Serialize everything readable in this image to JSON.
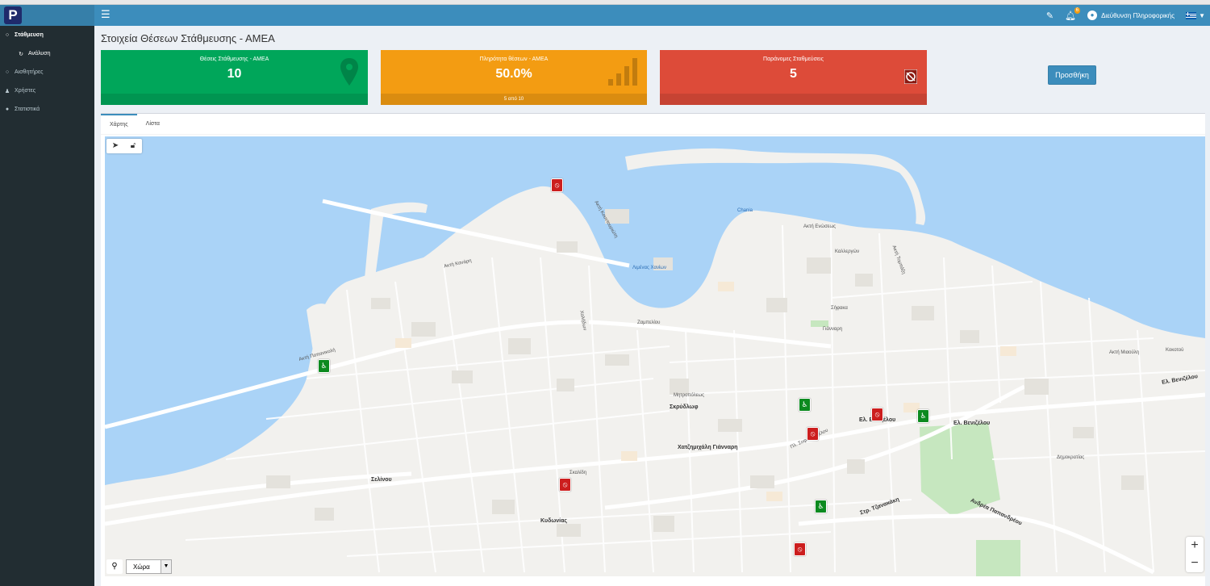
{
  "app": {
    "logo_letter": "P",
    "nav_toggle_icon": "hamburger-icon",
    "user_name": "Διεύθυνση Πληροφορικής",
    "notification_count": "6"
  },
  "sidebar": {
    "items": [
      {
        "label": "Στάθμευση",
        "icon": "circle-icon",
        "active": true
      },
      {
        "label": "Ανάλυση",
        "icon": "refresh-icon",
        "sub": true
      },
      {
        "label": "Αισθητήρες",
        "icon": "circle-icon"
      },
      {
        "label": "Χρήστες",
        "icon": "user-icon"
      },
      {
        "label": "Στατιστικά",
        "icon": "globe-icon"
      }
    ]
  },
  "page": {
    "title": "Στοιχεία Θέσεων Στάθμευσης - ΑΜΕΑ"
  },
  "stats": {
    "spaces_label": "Θέσεις Στάθμευσης - ΑΜΕΑ",
    "spaces_value": "10",
    "occupancy_label": "Πληρότητα θέσεων - ΑΜΕΑ",
    "occupancy_value": "50.0%",
    "occupancy_footer": "5 από 10",
    "illegal_label": "Παράνομες Σταθμεύσεις",
    "illegal_value": "5",
    "colors": {
      "green": "#00a65a",
      "orange": "#f39c12",
      "red": "#dd4b39"
    }
  },
  "actions": {
    "add_label": "Προσθήκη"
  },
  "tabs": [
    {
      "label": "Χάρτης",
      "active": true
    },
    {
      "label": "Λίστα",
      "active": false
    }
  ],
  "map": {
    "region_select": "Χώρα",
    "harbor_label": "Λιμένας Χανίων",
    "poi_label": "Chania",
    "streets": {
      "akti_koundourioti": "Ακτή Κουντουριώτη",
      "akti_enoseos": "Ακτή Ενώσεως",
      "akti_kanari": "Ακτή Κανάρη",
      "akti_papanikoli": "Ακτή Παπανικολή",
      "el_venizelou_1": "Ελ. Βενιζέλου",
      "el_venizelou_2": "Ελ. Βενιζέλου",
      "el_venizelou_3": "Ελ. Βενιζέλου",
      "andrea_papandreou": "Ανδρέα Παπανδρέου",
      "str_tzanakaki": "Στρ. Τζανακάκη",
      "selinou": "Σελίνου",
      "kydonias": "Κυδωνίας",
      "chatzimichali": "Χατζημιχάλη Γιάνναρη",
      "skridlof": "Σκρύδλωφ",
      "mitropoleos": "Μητροπόλεως",
      "kokotou": "Κοκοτού",
      "akti_miaouli": "Ακτή Μιαούλη",
      "sifaka": "Σήφακα",
      "zampeliou": "Ζαμπελίου",
      "sekeli": "Σκαλίδη",
      "dimokratias": "Δημοκρατίας",
      "kalergon": "Καλλεργών",
      "gianari": "Γιάνναρη",
      "chalidon": "Χαλήδων",
      "pl_sofokli": "Πλ. Σοφ. Βενιζέλου",
      "akti_tombazi": "Ακτή Τομπάζη"
    }
  }
}
